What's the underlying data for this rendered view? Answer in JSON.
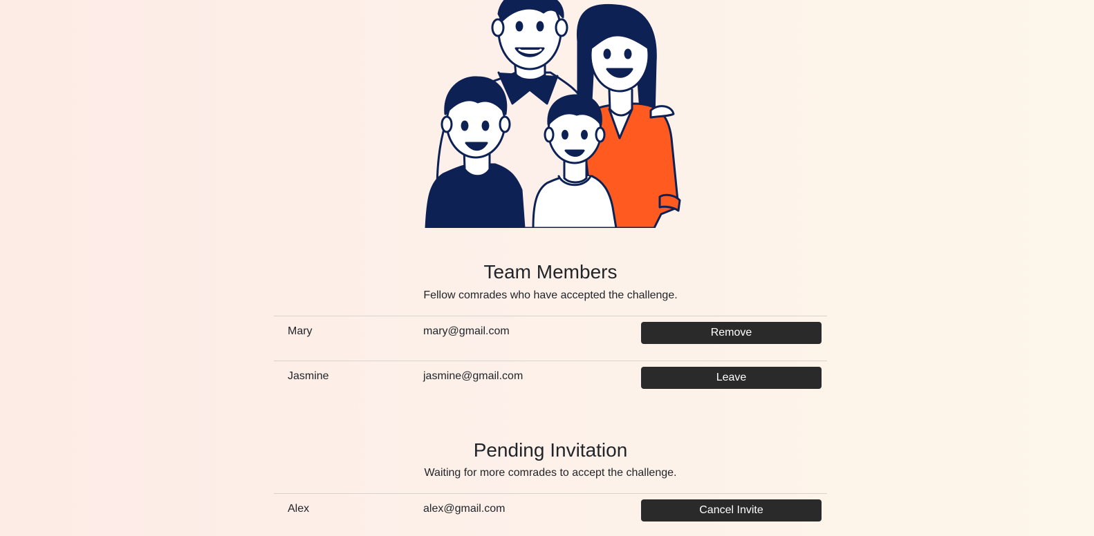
{
  "team_members": {
    "title": "Team Members",
    "subtitle": "Fellow comrades who have accepted the challenge.",
    "rows": [
      {
        "name": "Mary",
        "email": "mary@gmail.com",
        "action": "Remove"
      },
      {
        "name": "Jasmine",
        "email": "jasmine@gmail.com",
        "action": "Leave"
      }
    ]
  },
  "pending_invitation": {
    "title": "Pending Invitation",
    "subtitle": "Waiting for more comrades to accept the challenge.",
    "rows": [
      {
        "name": "Alex",
        "email": "alex@gmail.com",
        "action": "Cancel Invite"
      }
    ]
  },
  "colors": {
    "navy": "#0d2154",
    "orange": "#ff5a1f",
    "button_bg": "#2b2a2b"
  },
  "illustration": "family-illustration"
}
